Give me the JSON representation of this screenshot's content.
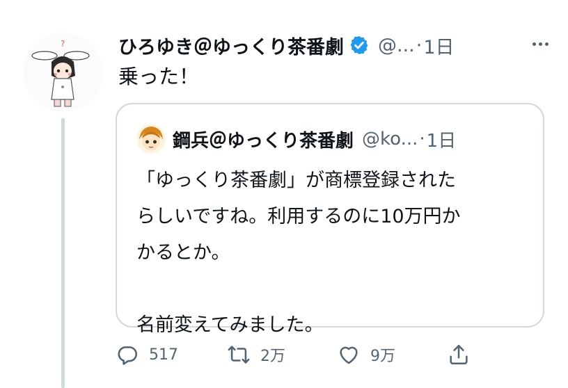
{
  "tweet": {
    "author_name": "ひろゆき＠ゆっくり茶番劇",
    "author_handle": "@...",
    "separator": "·",
    "time": "1日",
    "text": "乗った！"
  },
  "quote": {
    "author_name": "鋼兵＠ゆっくり茶番劇",
    "author_handle": "@ko...",
    "separator": "·",
    "time": "1日",
    "lines": [
      "「ゆっくり茶番劇」が商標登録された",
      "らしいですね。利用するのに10万円か",
      "かるとか。",
      "",
      "名前変えてみました。"
    ]
  },
  "actions": {
    "reply": {
      "icon": "reply-icon",
      "count": "517"
    },
    "retweet": {
      "icon": "retweet-icon",
      "count": "2万"
    },
    "like": {
      "icon": "heart-icon",
      "count": "9万"
    },
    "share": {
      "icon": "share-icon"
    }
  },
  "avatar_glyph": "?",
  "colors": {
    "text": "#0f1419",
    "secondary": "#536471",
    "border": "#cfd9de",
    "verified": "#1d9bf0"
  }
}
